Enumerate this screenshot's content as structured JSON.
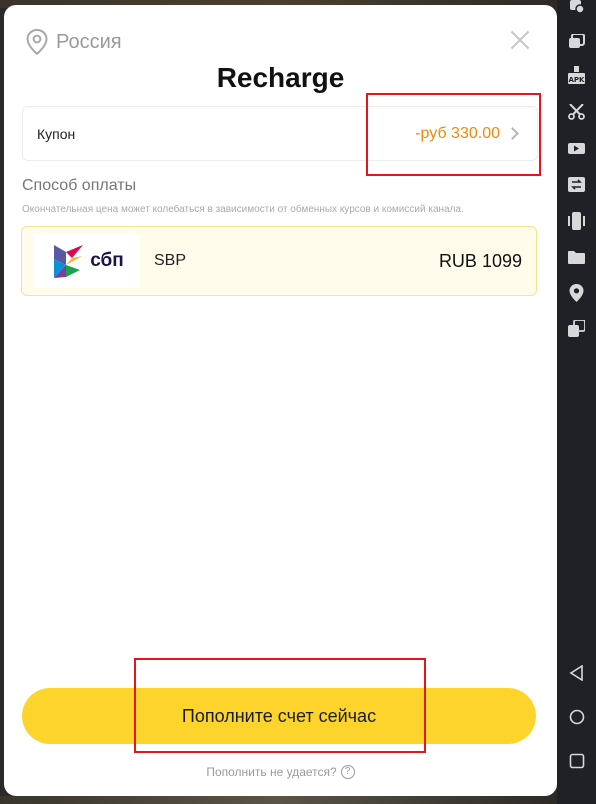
{
  "modal": {
    "region": "Россия",
    "title": "Recharge",
    "coupon": {
      "label": "Купон",
      "value": "-руб 330.00"
    },
    "payment": {
      "heading": "Способ оплаты",
      "note": "Окончательная цена может колебаться в зависимости от обменных курсов и комиссий канала.",
      "methods": [
        {
          "logo_text": "сбп",
          "name": "SBP",
          "price": "RUB 1099"
        }
      ]
    },
    "cta_label": "Пополните счет сейчас",
    "help_text": "Пополнить не удается?",
    "help_mark": "?"
  },
  "colors": {
    "accent": "#fdd42b",
    "coupon_value": "#f2870d",
    "highlight": "#e3161b"
  },
  "toolbar": {
    "icons": [
      "add-app-icon",
      "multi-window-icon",
      "apk-icon",
      "scissors-icon",
      "record-video-icon",
      "sync-icon",
      "shake-icon",
      "folder-icon",
      "location-icon",
      "rotate-icon"
    ],
    "apk_text": "APK"
  },
  "system_nav": [
    "back-icon",
    "home-icon",
    "recents-icon"
  ]
}
